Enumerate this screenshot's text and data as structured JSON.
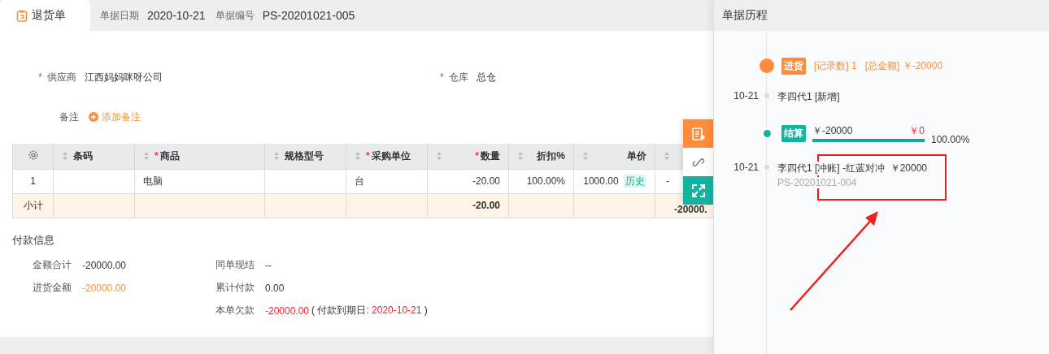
{
  "tab": {
    "label": "退货单",
    "selected": true
  },
  "header_fields": [
    {
      "label": "单据日期",
      "value": "2020-10-21"
    },
    {
      "label": "单据编号",
      "value": "PS-20201021-005"
    }
  ],
  "form": {
    "supplier": {
      "marker": "*",
      "label": "供应商",
      "value": "江西妈妈咪呀公司"
    },
    "warehouse": {
      "marker": "*",
      "label": "仓库",
      "value": "总仓"
    },
    "remark": {
      "label": "备注",
      "action": "添加备注"
    }
  },
  "table": {
    "columns": [
      {
        "kind": "settings"
      },
      {
        "kind": "text",
        "label": "条码"
      },
      {
        "kind": "text",
        "marker": "*",
        "label": "商品"
      },
      {
        "kind": "text",
        "label": "规格型号"
      },
      {
        "kind": "text",
        "marker": "*",
        "label": "采购单位"
      },
      {
        "kind": "number",
        "marker": "*",
        "label": "数量"
      },
      {
        "kind": "number",
        "label": "折扣%"
      },
      {
        "kind": "number",
        "label": "单价"
      },
      {
        "kind": "number"
      }
    ],
    "rows": [
      {
        "cells": [
          "1",
          null,
          "电脑",
          null,
          "台",
          "-20.00",
          "100.00%",
          "1000.00",
          "-"
        ],
        "price_tag": "历史"
      }
    ],
    "subtotal": {
      "cells": [
        "小计",
        null,
        null,
        null,
        null,
        "-20.00",
        null,
        null,
        "-20000."
      ]
    }
  },
  "payment": {
    "title": "付款信息",
    "left": [
      {
        "label": "金额合计",
        "value": "-20000.00",
        "kind": "plain"
      },
      {
        "label": "进货金额",
        "value": "-20000.00",
        "kind": "highlight"
      }
    ],
    "right": [
      {
        "label": "同单现结",
        "value": "--",
        "kind": "plain"
      },
      {
        "label": "累计付款",
        "value": "0.00",
        "kind": "plain"
      },
      {
        "label": "本单欠款",
        "value": "-20000.00",
        "kind": "alert",
        "note_before": "( 付款到期日:",
        "due_date": "2020-10-21",
        "note_after": ")"
      }
    ]
  },
  "history": {
    "title": "单据历程",
    "groups": [
      {
        "kind": "purchase",
        "tag": "进货",
        "count": "[记录数] 1",
        "total": "[总金额] ￥-20000",
        "entries": [
          {
            "date": "10-21",
            "text": "李四代1 [新增]"
          }
        ]
      },
      {
        "kind": "settlement",
        "tag": "结算",
        "amount": "￥-20000",
        "remaining": "￥0",
        "level": 1,
        "percent": "100.00%",
        "entries": [
          {
            "date": "10-21",
            "text": "李四代1 [冲账] -红蓝对冲  ￥20000",
            "ref": "PS-20201021-004"
          }
        ]
      }
    ]
  }
}
